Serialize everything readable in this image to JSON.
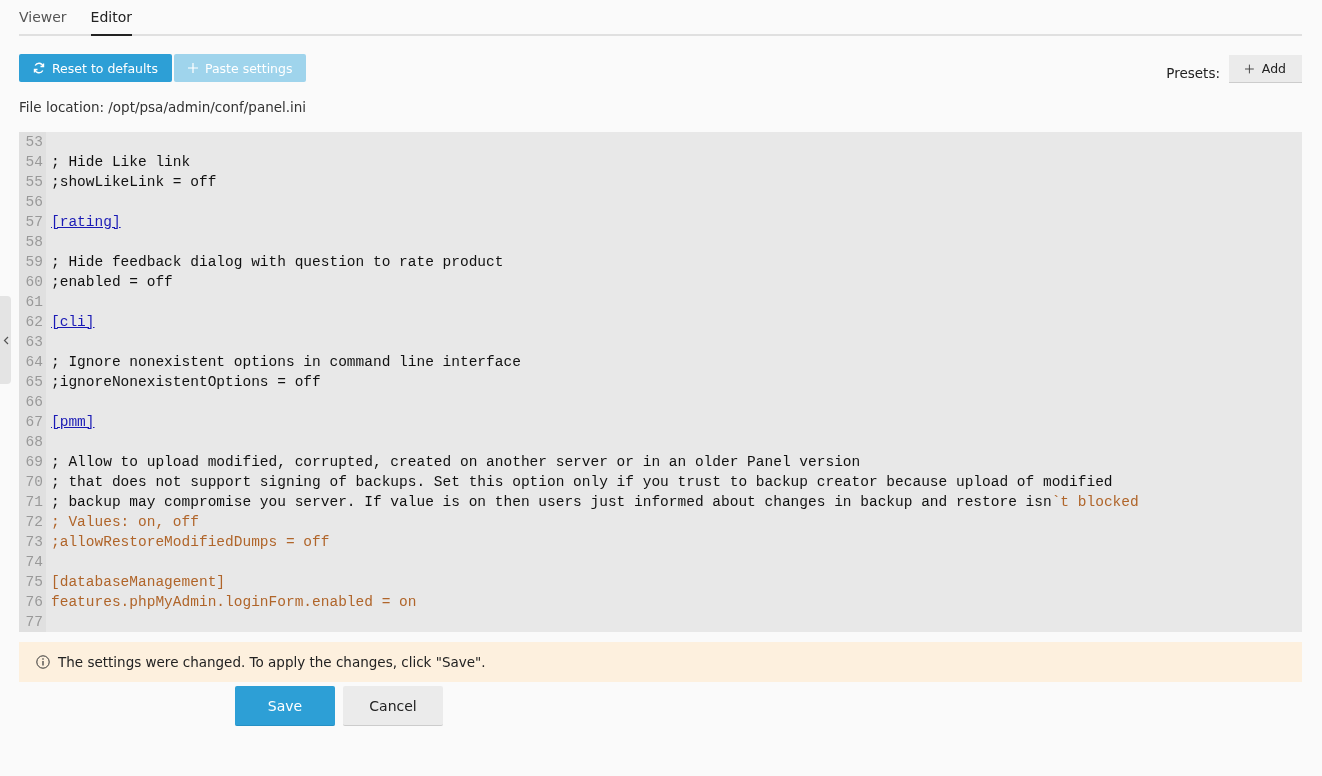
{
  "tabs": [
    {
      "label": "Viewer",
      "selected": false
    },
    {
      "label": "Editor",
      "selected": true
    }
  ],
  "toolbar": {
    "buttons": [
      {
        "label": "Reset to defaults",
        "disabled": false
      },
      {
        "label": "Paste settings",
        "disabled": true
      }
    ],
    "presets_label": "Presets:",
    "presets_button": "Add"
  },
  "file_location": "File location: /opt/psa/admin/conf/panel.ini",
  "editor": {
    "lines": [
      {
        "number": "53"
      },
      {
        "number": "54",
        "segments": [
          {
            "text": "; Hide Like link",
            "kind": "plain"
          }
        ]
      },
      {
        "number": "55",
        "segments": [
          {
            "text": ";showLikeLink = off",
            "kind": "plain"
          }
        ]
      },
      {
        "number": "56"
      },
      {
        "number": "57",
        "segments": [
          {
            "text": "[rating]",
            "kind": "link"
          }
        ]
      },
      {
        "number": "58"
      },
      {
        "number": "59",
        "segments": [
          {
            "text": "; Hide feedback dialog with question to rate product",
            "kind": "plain"
          }
        ]
      },
      {
        "number": "60",
        "segments": [
          {
            "text": ";enabled = off",
            "kind": "plain"
          }
        ]
      },
      {
        "number": "61"
      },
      {
        "number": "62",
        "segments": [
          {
            "text": "[cli]",
            "kind": "link"
          }
        ]
      },
      {
        "number": "63"
      },
      {
        "number": "64",
        "segments": [
          {
            "text": "; Ignore nonexistent options in command line interface",
            "kind": "plain"
          }
        ]
      },
      {
        "number": "65",
        "segments": [
          {
            "text": ";ignoreNonexistentOptions = off",
            "kind": "plain"
          }
        ]
      },
      {
        "number": "66"
      },
      {
        "number": "67",
        "segments": [
          {
            "text": "[pmm]",
            "kind": "link"
          }
        ]
      },
      {
        "number": "68"
      },
      {
        "number": "69",
        "segments": [
          {
            "text": "; Allow to upload modified, corrupted, created on another server or in an older Panel version",
            "kind": "plain"
          }
        ]
      },
      {
        "number": "70",
        "segments": [
          {
            "text": "; that does not support signing of backups. Set this option only if you trust to backup creator because upload of modified",
            "kind": "plain"
          }
        ]
      },
      {
        "number": "71",
        "segments": [
          {
            "text": "; backup may compromise you server. If value is on then users just informed about changes in backup and restore isn",
            "kind": "plain"
          },
          {
            "text": "`t blocked",
            "kind": "string"
          }
        ]
      },
      {
        "number": "72",
        "segments": [
          {
            "text": "; Values: on, off",
            "kind": "string"
          }
        ]
      },
      {
        "number": "73",
        "segments": [
          {
            "text": ";allowRestoreModifiedDumps = off",
            "kind": "string"
          }
        ]
      },
      {
        "number": "74"
      },
      {
        "number": "75",
        "segments": [
          {
            "text": "[databaseManagement]",
            "kind": "string"
          }
        ]
      },
      {
        "number": "76",
        "segments": [
          {
            "text": "features.phpMyAdmin.loginForm.enabled = on",
            "kind": "string"
          }
        ]
      },
      {
        "number": "77"
      }
    ]
  },
  "notice": "The settings were changed. To apply the changes, click \"Save\".",
  "actions": [
    {
      "label": "Save",
      "kind": "primary"
    },
    {
      "label": "Cancel",
      "kind": "secondary"
    }
  ]
}
